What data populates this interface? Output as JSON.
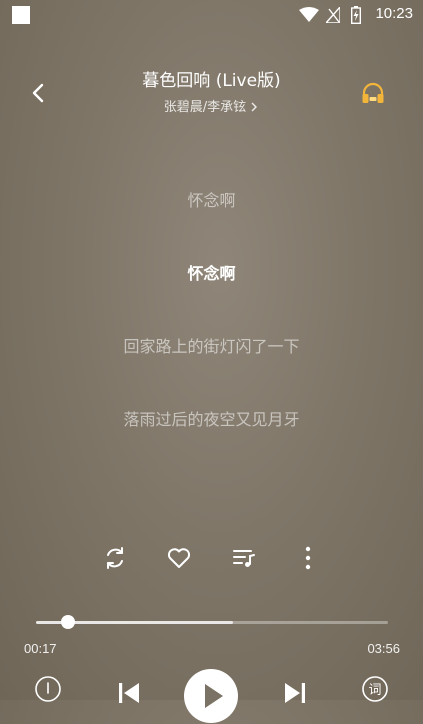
{
  "status_bar": {
    "time": "10:23"
  },
  "song": {
    "title": "暮色回响 (Live版)",
    "artists": "张碧晨/李承铉"
  },
  "lyrics": {
    "lines": [
      "怀念啊",
      "怀念啊",
      "回家路上的街灯闪了一下",
      "落雨过后的夜空又见月牙"
    ],
    "current_index": 1
  },
  "playback": {
    "elapsed": "00:17",
    "duration": "03:56",
    "progress_fraction": 0.09,
    "buffered_fraction": 0.56
  },
  "controls": {
    "lyrics_button_glyph": "词"
  },
  "icons": {
    "back": "chevron-left-icon",
    "headphone": "headphone-icon",
    "loop": "repeat-icon",
    "like": "heart-icon",
    "playlist": "playlist-icon",
    "more": "more-vertical-icon",
    "download": "download-icon",
    "prev": "skip-previous-icon",
    "play": "play-icon",
    "next": "skip-next-icon",
    "lyrics": "lyrics-icon"
  },
  "colors": {
    "background": "#7f7668",
    "headphone_accent": "#f2b53a",
    "text_primary": "#ffffff"
  }
}
